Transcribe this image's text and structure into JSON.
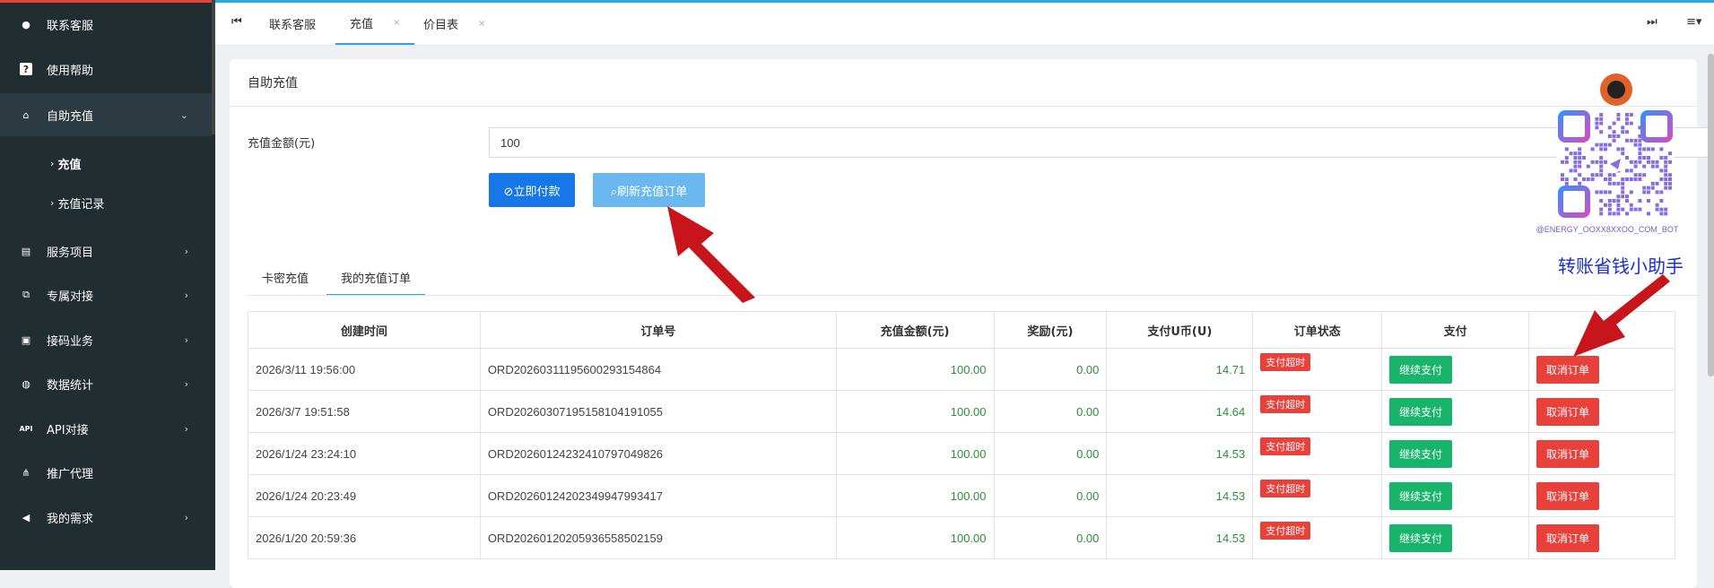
{
  "sidebar": {
    "items": [
      {
        "label": "联系客服",
        "icon": "chat-icon"
      },
      {
        "label": "使用帮助",
        "icon": "help-icon"
      },
      {
        "label": "自助充值",
        "icon": "bank-icon",
        "expanded": true
      },
      {
        "label": "服务项目",
        "icon": "list-icon"
      },
      {
        "label": "专属对接",
        "icon": "link-icon"
      },
      {
        "label": "接码业务",
        "icon": "sms-icon"
      },
      {
        "label": "数据统计",
        "icon": "database-icon"
      },
      {
        "label": "API对接",
        "icon": "api-icon"
      },
      {
        "label": "推广代理",
        "icon": "sitemap-icon"
      },
      {
        "label": "我的需求",
        "icon": "megaphone-icon"
      }
    ],
    "subitems": [
      {
        "label": "充值",
        "active": true
      },
      {
        "label": "充值记录"
      }
    ]
  },
  "tabs": [
    {
      "label": "联系客服"
    },
    {
      "label": "充值",
      "active": true
    },
    {
      "label": "价目表"
    }
  ],
  "panel": {
    "title": "自助充值",
    "amount_label": "充值金额(元)",
    "amount_value": "100",
    "pay_now": "立即付款",
    "refresh": "刷新充值订单"
  },
  "subtabs": [
    {
      "label": "卡密充值"
    },
    {
      "label": "我的充值订单",
      "active": true
    }
  ],
  "table": {
    "headers": [
      "创建时间",
      "订单号",
      "充值金额(元)",
      "奖励(元)",
      "支付U币(U)",
      "订单状态",
      "支付",
      ""
    ],
    "rows": [
      {
        "time": "2026/3/11 19:56:00",
        "order": "ORD20260311195600293154864",
        "amount": "100.00",
        "bonus": "0.00",
        "u": "14.71",
        "status": "支付超时",
        "pay": "继续支付",
        "cancel": "取消订单"
      },
      {
        "time": "2026/3/7 19:51:58",
        "order": "ORD20260307195158104191055",
        "amount": "100.00",
        "bonus": "0.00",
        "u": "14.64",
        "status": "支付超时",
        "pay": "继续支付",
        "cancel": "取消订单"
      },
      {
        "time": "2026/1/24 23:24:10",
        "order": "ORD20260124232410797049826",
        "amount": "100.00",
        "bonus": "0.00",
        "u": "14.53",
        "status": "支付超时",
        "pay": "继续支付",
        "cancel": "取消订单"
      },
      {
        "time": "2026/1/24 20:23:49",
        "order": "ORD20260124202349947993417",
        "amount": "100.00",
        "bonus": "0.00",
        "u": "14.53",
        "status": "支付超时",
        "pay": "继续支付",
        "cancel": "取消订单"
      },
      {
        "time": "2026/1/20 20:59:36",
        "order": "ORD20260120205936558502159",
        "amount": "100.00",
        "bonus": "0.00",
        "u": "14.53",
        "status": "支付超时",
        "pay": "继续支付",
        "cancel": "取消订单"
      }
    ]
  },
  "qr": {
    "caption": "@ENERGY_OOXX8XXOO_COM_BOT"
  },
  "promo": "转账省钱小助手",
  "colors": {
    "sidebar": "#222d32",
    "accent": "#29a6e6",
    "primary": "#1677e8",
    "danger": "#e8403b",
    "success": "#19b46b",
    "arrow": "#c8141b"
  }
}
